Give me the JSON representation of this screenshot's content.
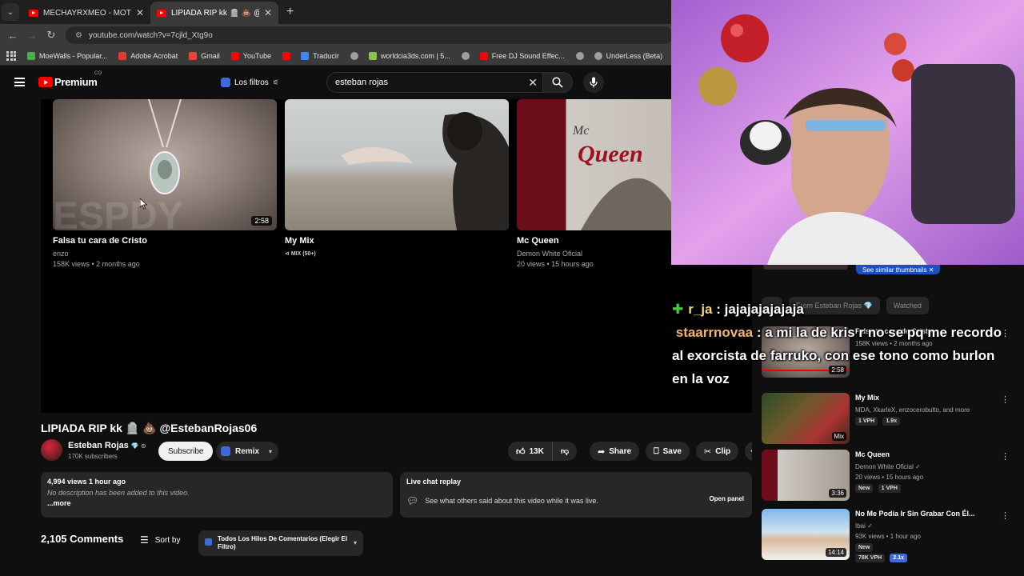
{
  "browser": {
    "tabs": [
      {
        "title": "MECHAYRXMEO - MOTORSPOR",
        "active": false
      },
      {
        "title": "LIPIADA RIP kk 🪦 💩 @Esteba",
        "active": true
      }
    ],
    "new_tab": "+",
    "url": "youtube.com/watch?v=7cjld_Xtg9o",
    "bookmarks": [
      {
        "label": "MoeWalls - Popular...",
        "color": "#4caf50"
      },
      {
        "label": "Adobe Acrobat",
        "color": "#e53935"
      },
      {
        "label": "Gmail",
        "color": "#ea4335"
      },
      {
        "label": "YouTube",
        "color": "#ff0000"
      },
      {
        "label": "",
        "color": "#ff0000"
      },
      {
        "label": "Traducir",
        "color": "#4285f4"
      },
      {
        "label": "",
        "color": "#9e9e9e"
      },
      {
        "label": "worldcia3ds.com | 5...",
        "color": "#8bc34a"
      },
      {
        "label": "",
        "color": "#9e9e9e"
      },
      {
        "label": "Free DJ Sound Effec...",
        "color": "#ff0000"
      },
      {
        "label": "",
        "color": "#9e9e9e"
      },
      {
        "label": "UnderLess (Beta)",
        "color": "#9e9e9e"
      }
    ]
  },
  "yt_header": {
    "logo": "Premium",
    "country": "CO",
    "filters": "Los filtros",
    "search_value": "esteban rojas",
    "clear": "✕"
  },
  "end_screen": [
    {
      "title": "Falsa tu cara de Cristo",
      "line1": "enzo",
      "line2": "158K views • 2 months ago",
      "duration": "2:58"
    },
    {
      "title": "My Mix",
      "line1": "MIX (50+)",
      "line2": "",
      "duration": ""
    },
    {
      "title": "Mc Queen",
      "line1": "Demon White Oficial",
      "line2": "20 views • 15 hours ago",
      "duration": ""
    }
  ],
  "video": {
    "title": "LIPIADA RIP kk 🪦 💩 @EstebanRojas06",
    "channel": "Esteban Rojas",
    "subscribers": "170K subscribers",
    "subscribe": "Subscribe",
    "remix": "Remix",
    "likes": "13K",
    "share": "Share",
    "save": "Save",
    "clip": "Clip",
    "more": "⋯"
  },
  "description": {
    "stats": "4,994 views  1 hour ago",
    "text": "No description has been added to this video.",
    "more": "...more"
  },
  "live_chat": {
    "header": "Live chat replay",
    "text": "See what others said about this video while it was live.",
    "open": "Open panel"
  },
  "comments": {
    "count": "2,105 Comments",
    "sort": "Sort by",
    "filter": "Todos Los Hilos De Comentarios (Elegir El Filtro)"
  },
  "right": {
    "similar": "See similar thumbnails  ✕",
    "chips": [
      "",
      "From Esteban Rojas 💎",
      "Watched"
    ],
    "recs": [
      {
        "title": "Falsa tu cara de Cristo",
        "l1": "158K views • 2 months ago",
        "l2": "",
        "dur": "2:58",
        "tags": []
      },
      {
        "title": "My Mix",
        "l1": "MDA, XkarleX, enzocerobulto, and more",
        "l2": "",
        "dur": "Mix",
        "tags": [
          "1 VPH",
          "1.9x"
        ]
      },
      {
        "title": "Mc Queen",
        "l1": "Demon White Oficial ✓",
        "l2": "20 views • 15 hours ago",
        "dur": "3:36",
        "tags": [
          "New",
          "1 VPH"
        ]
      },
      {
        "title": "No Me Podía Ir Sin Grabar Con Él...",
        "l1": "Ibai ✓",
        "l2": "93K views • 1 hour ago",
        "dur": "14:14",
        "tags": [
          "New",
          "78K VPH",
          "2.1x"
        ]
      }
    ]
  },
  "chat_overlay": [
    {
      "user": "r_ja",
      "text": "jajajajajajaja"
    },
    {
      "user": "staarrnovaa",
      "text": "a mi la de kris r no se pq me recordo al exorcista de farruko, con ese tono como burlon en la voz"
    }
  ]
}
